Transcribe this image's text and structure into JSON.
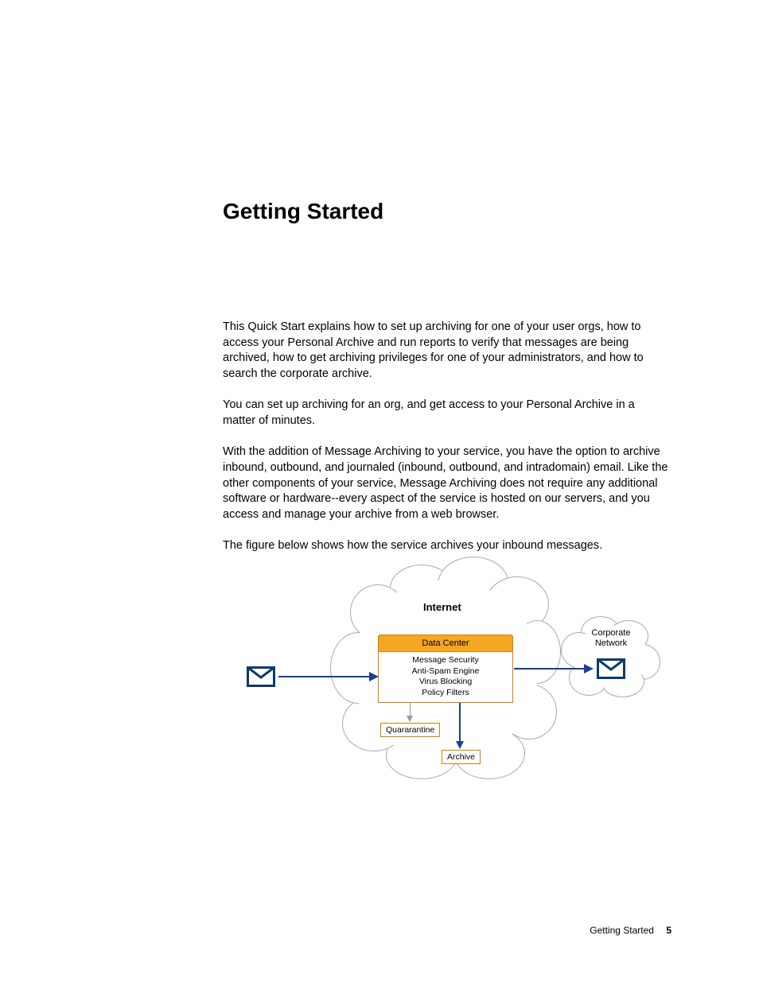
{
  "heading": "Getting Started",
  "paragraphs": {
    "p1": "This Quick Start explains how to set up archiving for one of your user orgs, how to access your Personal Archive and run reports to verify that messages are being archived, how to get archiving privileges for one of your administrators, and how to search the corporate archive.",
    "p2": "You can set up archiving for an org, and get access to your Personal Archive in a matter of minutes.",
    "p3": "With the addition of Message Archiving to your service, you have the option to archive inbound, outbound, and journaled (inbound, outbound, and intradomain) email. Like the other components of your service, Message Archiving does not require any additional software or hardware--every aspect of the service is hosted on our servers, and you access and manage your archive from a web browser.",
    "p4": "The figure below shows how the service archives your inbound messages."
  },
  "figure": {
    "internet_label": "Internet",
    "data_center": "Data Center",
    "security": {
      "l1": "Message Security",
      "l2": "Anti-Spam Engine",
      "l3": "Virus Blocking",
      "l4": "Policy Filters"
    },
    "quarantine": "Quararantine",
    "archive": "Archive",
    "corporate_l1": "Corporate",
    "corporate_l2": "Network"
  },
  "footer": {
    "section": "Getting Started",
    "page": "5"
  }
}
